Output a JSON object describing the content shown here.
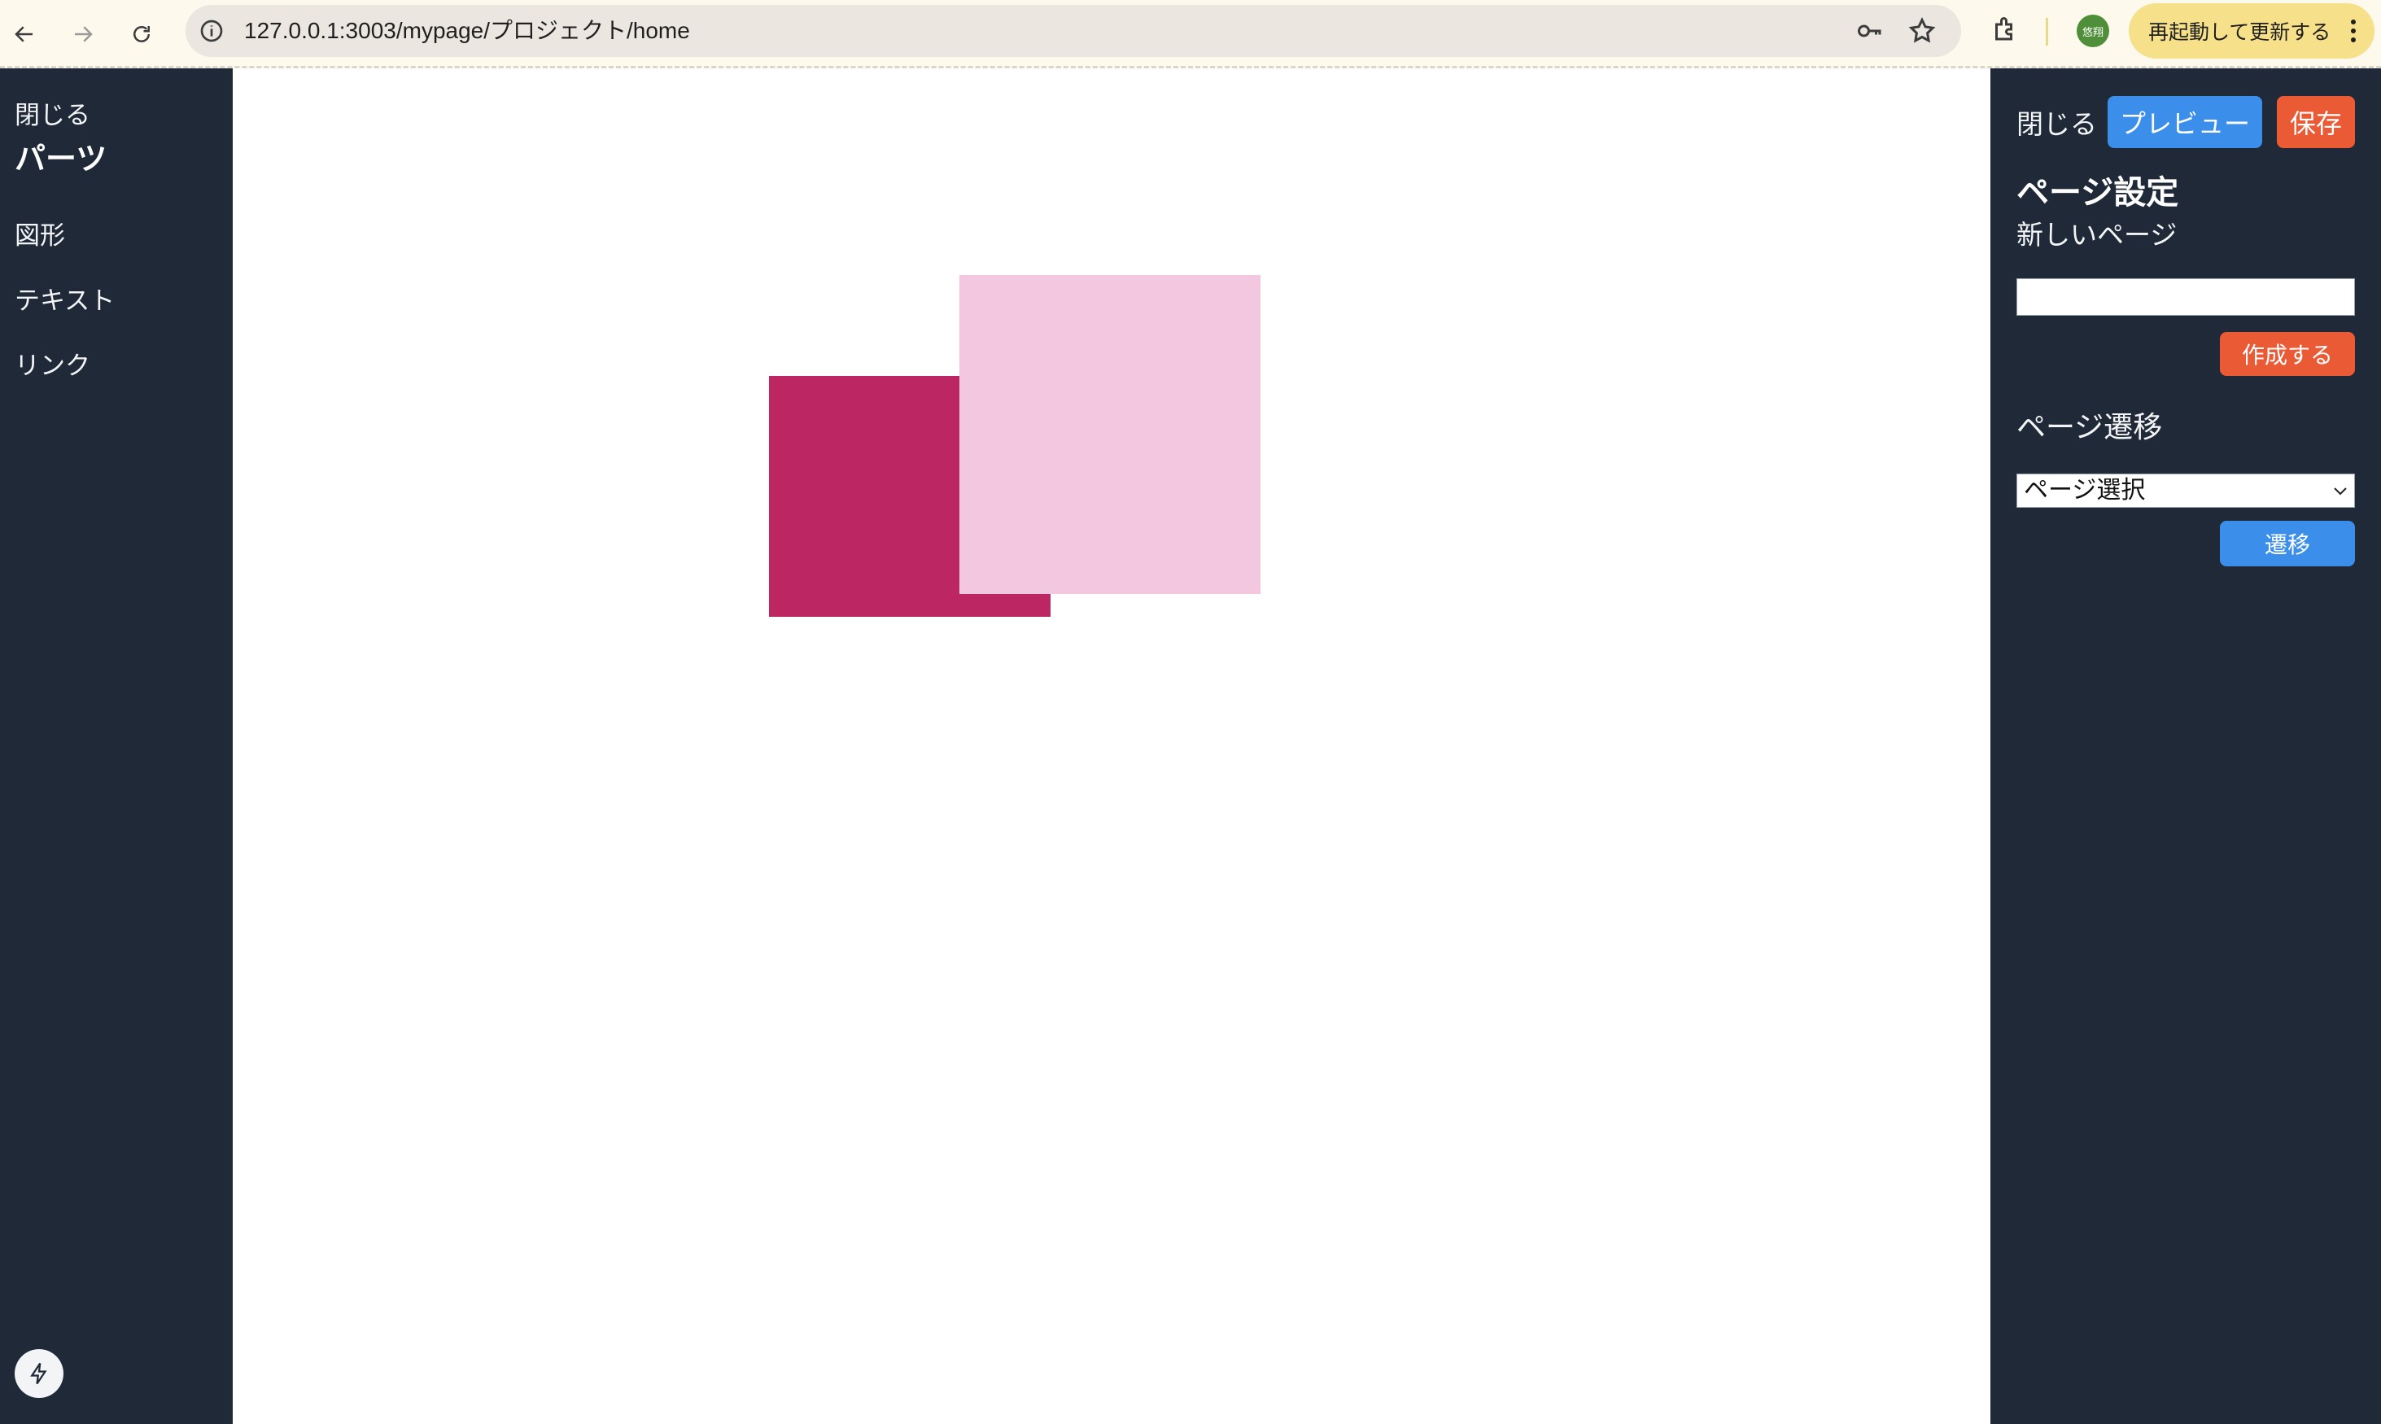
{
  "browser": {
    "url": "127.0.0.1:3003/mypage/プロジェクト/home",
    "profile_initial": "悠翔",
    "update_label": "再起動して更新する"
  },
  "left_panel": {
    "close_label": "閉じる",
    "title": "パーツ",
    "items": [
      {
        "label": "図形"
      },
      {
        "label": "テキスト"
      },
      {
        "label": "リンク"
      }
    ]
  },
  "canvas": {
    "shapes": [
      {
        "name": "crimson-rectangle",
        "color": "#bc2663"
      },
      {
        "name": "pink-rectangle",
        "color": "#f3c7e0"
      }
    ]
  },
  "right_panel": {
    "close_label": "閉じる",
    "preview_label": "プレビュー",
    "save_label": "保存",
    "heading": "ページ設定",
    "new_page_label": "新しいページ",
    "new_page_value": "",
    "create_label": "作成する",
    "navigation_title": "ページ遷移",
    "page_select_value": "ページ選択",
    "go_label": "遷移"
  },
  "colors": {
    "panel_bg": "#1f2937",
    "primary_blue": "#3b8eea",
    "accent_orange": "#ea5a35"
  }
}
